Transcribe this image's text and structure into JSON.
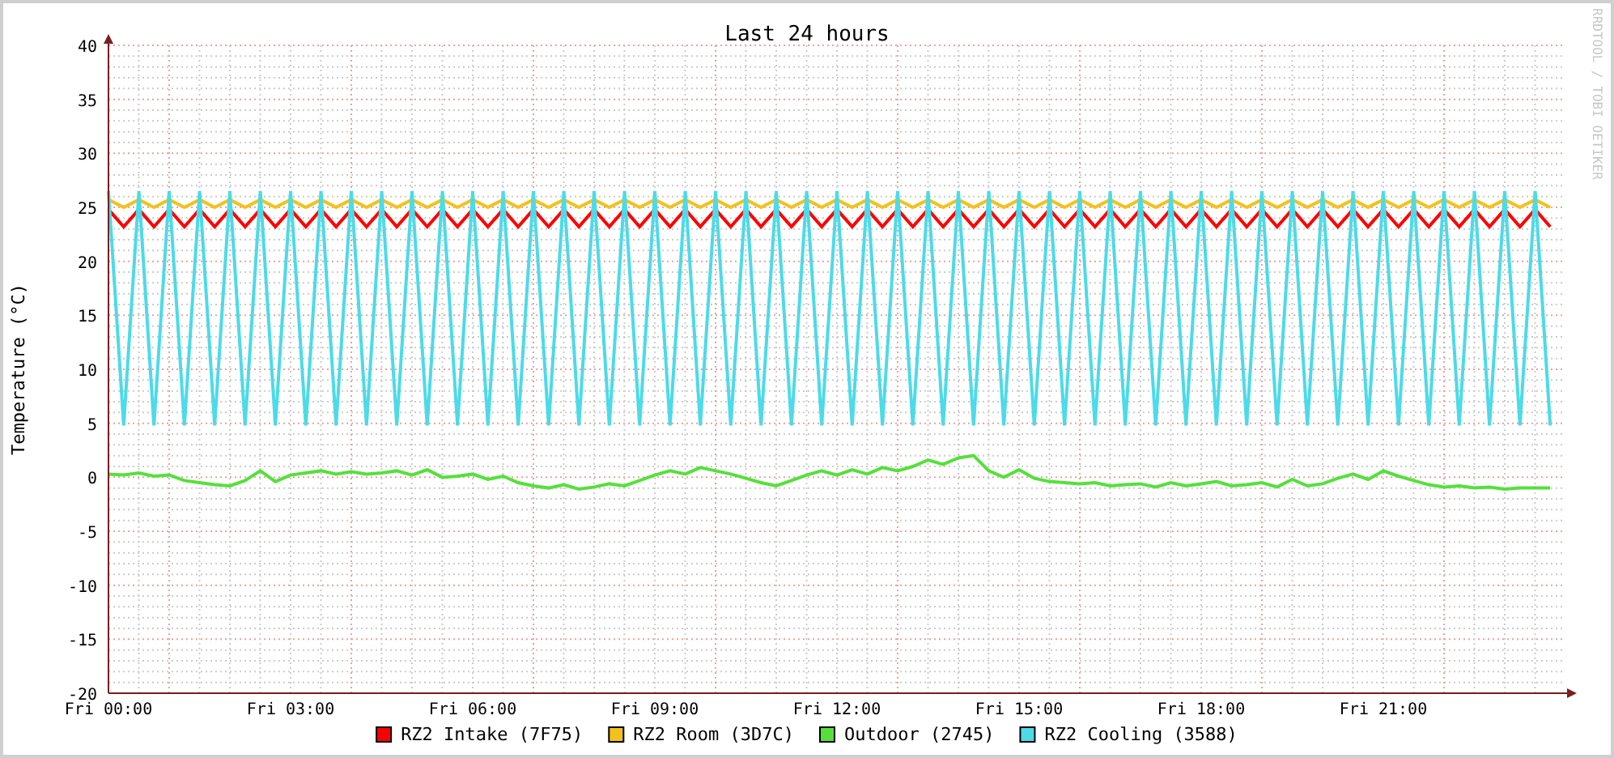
{
  "graph": {
    "credit": "RRDTOOL / TOBI OETIKER",
    "chart_data": {
      "type": "line",
      "title": "Last 24 hours",
      "ylabel": "Temperature (°C)",
      "ylim": [
        -20,
        40
      ],
      "grid": true,
      "legend": "bottom",
      "yticks": [
        {
          "value": -20,
          "label": "-20"
        },
        {
          "value": -15,
          "label": "-15"
        },
        {
          "value": -10,
          "label": "-10"
        },
        {
          "value": -5,
          "label": "-5"
        },
        {
          "value": 0,
          "label": "0"
        },
        {
          "value": 5,
          "label": "5"
        },
        {
          "value": 10,
          "label": "10"
        },
        {
          "value": 15,
          "label": "15"
        },
        {
          "value": 20,
          "label": "20"
        },
        {
          "value": 25,
          "label": "25"
        },
        {
          "value": 30,
          "label": "30"
        },
        {
          "value": 35,
          "label": "35"
        },
        {
          "value": 40,
          "label": "40"
        }
      ],
      "categories": [
        "Fri 00:00",
        null,
        null,
        null,
        null,
        null,
        null,
        null,
        null,
        null,
        null,
        null,
        "Fri 03:00",
        null,
        null,
        null,
        null,
        null,
        null,
        null,
        null,
        null,
        null,
        null,
        "Fri 06:00",
        null,
        null,
        null,
        null,
        null,
        null,
        null,
        null,
        null,
        null,
        null,
        "Fri 09:00",
        null,
        null,
        null,
        null,
        null,
        null,
        null,
        null,
        null,
        null,
        null,
        "Fri 12:00",
        null,
        null,
        null,
        null,
        null,
        null,
        null,
        null,
        null,
        null,
        null,
        "Fri 15:00",
        null,
        null,
        null,
        null,
        null,
        null,
        null,
        null,
        null,
        null,
        null,
        "Fri 18:00",
        null,
        null,
        null,
        null,
        null,
        null,
        null,
        null,
        null,
        null,
        null,
        "Fri 21:00",
        null,
        null,
        null,
        null,
        null,
        null,
        null,
        null,
        null,
        null,
        null
      ],
      "series": [
        {
          "name": "RZ2 Intake (7F75)",
          "color": "#ff0000",
          "values": [
            24.8,
            23.2,
            24.8,
            23.2,
            24.8,
            23.2,
            24.8,
            23.2,
            24.8,
            23.2,
            24.8,
            23.2,
            24.8,
            23.2,
            24.8,
            23.2,
            24.8,
            23.2,
            24.8,
            23.2,
            24.8,
            23.2,
            24.8,
            23.2,
            24.8,
            23.2,
            24.8,
            23.2,
            24.8,
            23.2,
            24.8,
            23.2,
            24.8,
            23.2,
            24.8,
            23.2,
            24.8,
            23.2,
            24.8,
            23.2,
            24.8,
            23.2,
            24.8,
            23.2,
            24.8,
            23.2,
            24.8,
            23.2,
            24.8,
            23.2,
            24.8,
            23.2,
            24.8,
            23.2,
            24.8,
            23.2,
            24.8,
            23.2,
            24.8,
            23.2,
            24.8,
            23.2,
            24.8,
            23.2,
            24.8,
            23.2,
            24.8,
            23.2,
            24.8,
            23.2,
            24.8,
            23.2,
            24.8,
            23.2,
            24.8,
            23.2,
            24.8,
            23.2,
            24.8,
            23.2,
            24.8,
            23.2,
            24.8,
            23.2,
            24.8,
            23.2,
            24.8,
            23.2,
            24.8,
            23.2,
            24.8,
            23.2,
            24.8,
            23.2,
            24.8,
            23.2
          ]
        },
        {
          "name": "RZ2 Room (3D7C)",
          "color": "#f2c21c",
          "values": [
            25.7,
            25.0,
            25.7,
            25.0,
            25.7,
            25.0,
            25.7,
            25.0,
            25.7,
            25.0,
            25.7,
            25.0,
            25.7,
            25.0,
            25.7,
            25.0,
            25.7,
            25.0,
            25.7,
            25.0,
            25.7,
            25.0,
            25.7,
            25.0,
            25.7,
            25.0,
            25.7,
            25.0,
            25.7,
            25.0,
            25.7,
            25.0,
            25.7,
            25.0,
            25.7,
            25.0,
            25.7,
            25.0,
            25.7,
            25.0,
            25.7,
            25.0,
            25.7,
            25.0,
            25.7,
            25.0,
            25.7,
            25.0,
            25.7,
            25.0,
            25.7,
            25.0,
            25.7,
            25.0,
            25.7,
            25.0,
            25.7,
            25.0,
            25.7,
            25.0,
            25.7,
            25.0,
            25.7,
            25.0,
            25.7,
            25.0,
            25.7,
            25.0,
            25.7,
            25.0,
            25.7,
            25.0,
            25.7,
            25.0,
            25.7,
            25.0,
            25.7,
            25.0,
            25.7,
            25.0,
            25.7,
            25.0,
            25.7,
            25.0,
            25.7,
            25.0,
            25.7,
            25.0,
            25.7,
            25.0,
            25.7,
            25.0,
            25.7,
            25.0,
            25.7,
            25.0
          ]
        },
        {
          "name": "Outdoor (2745)",
          "color": "#55e03c",
          "values": [
            0.3,
            0.2,
            0.4,
            0.1,
            0.2,
            -0.3,
            -0.5,
            -0.7,
            -0.8,
            -0.3,
            0.6,
            -0.4,
            0.2,
            0.4,
            0.6,
            0.3,
            0.5,
            0.3,
            0.4,
            0.6,
            0.2,
            0.7,
            0.0,
            0.1,
            0.3,
            -0.2,
            0.1,
            -0.5,
            -0.8,
            -1.0,
            -0.7,
            -1.1,
            -0.9,
            -0.6,
            -0.8,
            -0.3,
            0.2,
            0.6,
            0.3,
            0.9,
            0.6,
            0.3,
            -0.1,
            -0.5,
            -0.8,
            -0.3,
            0.2,
            0.6,
            0.2,
            0.7,
            0.3,
            0.9,
            0.6,
            1.0,
            1.6,
            1.2,
            1.8,
            2.0,
            0.6,
            0.0,
            0.7,
            -0.1,
            -0.4,
            -0.5,
            -0.6,
            -0.5,
            -0.8,
            -0.7,
            -0.6,
            -0.9,
            -0.5,
            -0.8,
            -0.6,
            -0.4,
            -0.8,
            -0.7,
            -0.5,
            -0.9,
            -0.2,
            -0.8,
            -0.6,
            -0.1,
            0.3,
            -0.2,
            0.6,
            0.1,
            -0.3,
            -0.7,
            -0.9,
            -0.8,
            -1.0,
            -0.9,
            -1.1,
            -1.0,
            -1.0,
            -1.0
          ]
        },
        {
          "name": "RZ2 Cooling (3588)",
          "color": "#4cdbe8",
          "values": [
            26.5,
            4.8,
            26.5,
            4.8,
            26.5,
            4.8,
            26.5,
            4.8,
            26.5,
            4.8,
            26.5,
            4.8,
            26.5,
            4.8,
            26.5,
            4.8,
            26.5,
            4.8,
            26.5,
            4.8,
            26.5,
            4.8,
            26.5,
            4.8,
            26.5,
            4.8,
            26.5,
            4.8,
            26.5,
            4.8,
            26.5,
            4.8,
            26.5,
            4.8,
            26.5,
            4.8,
            26.5,
            4.8,
            26.5,
            4.8,
            26.5,
            4.8,
            26.5,
            4.8,
            26.5,
            4.8,
            26.5,
            4.8,
            26.5,
            4.8,
            26.5,
            4.8,
            26.5,
            4.8,
            26.5,
            4.8,
            26.5,
            4.8,
            26.5,
            4.8,
            26.5,
            4.8,
            26.5,
            4.8,
            26.5,
            4.8,
            26.5,
            4.8,
            26.5,
            4.8,
            26.5,
            4.8,
            26.5,
            4.8,
            26.5,
            4.8,
            26.5,
            4.8,
            26.5,
            4.8,
            26.5,
            4.8,
            26.5,
            4.8,
            26.5,
            4.8,
            26.5,
            4.8,
            26.5,
            4.8,
            26.5,
            4.8,
            26.5,
            4.8,
            26.5,
            4.8
          ]
        }
      ]
    }
  }
}
